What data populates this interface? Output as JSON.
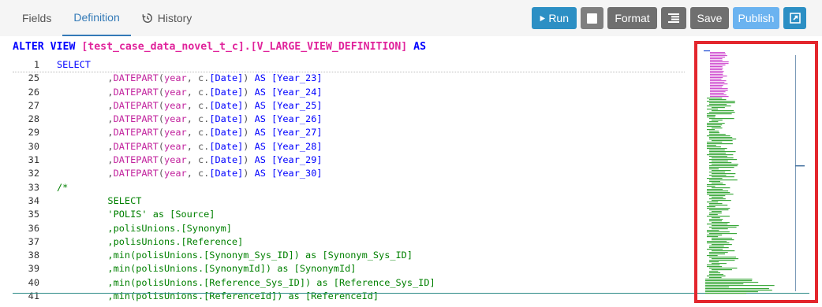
{
  "tabs": [
    {
      "label": "Fields",
      "active": false
    },
    {
      "label": "Definition",
      "active": true
    },
    {
      "label": "History",
      "active": false
    }
  ],
  "toolbar": {
    "run_label": "Run",
    "format_label": "Format",
    "save_label": "Save",
    "publish_label": "Publish"
  },
  "editor": {
    "header": {
      "keyword1": "ALTER VIEW ",
      "object_name": "[test_case_data_novel_t_c].[V_LARGE_VIEW_DEFINITION]",
      "keyword2": " AS"
    },
    "sticky_line": {
      "number": "1",
      "text": "SELECT"
    },
    "lines": [
      {
        "n": "25",
        "parts": [
          [
            "plain",
            "         ,"
          ],
          [
            "fn",
            "DATEPART"
          ],
          [
            "plain",
            "("
          ],
          [
            "fn",
            "year"
          ],
          [
            "plain",
            ", c."
          ],
          [
            "kw",
            "[Date]"
          ],
          [
            "plain",
            ") "
          ],
          [
            "kw",
            "AS [Year_23]"
          ]
        ]
      },
      {
        "n": "26",
        "parts": [
          [
            "plain",
            "         ,"
          ],
          [
            "fn",
            "DATEPART"
          ],
          [
            "plain",
            "("
          ],
          [
            "fn",
            "year"
          ],
          [
            "plain",
            ", c."
          ],
          [
            "kw",
            "[Date]"
          ],
          [
            "plain",
            ") "
          ],
          [
            "kw",
            "AS [Year_24]"
          ]
        ]
      },
      {
        "n": "27",
        "parts": [
          [
            "plain",
            "         ,"
          ],
          [
            "fn",
            "DATEPART"
          ],
          [
            "plain",
            "("
          ],
          [
            "fn",
            "year"
          ],
          [
            "plain",
            ", c."
          ],
          [
            "kw",
            "[Date]"
          ],
          [
            "plain",
            ") "
          ],
          [
            "kw",
            "AS [Year_25]"
          ]
        ]
      },
      {
        "n": "28",
        "parts": [
          [
            "plain",
            "         ,"
          ],
          [
            "fn",
            "DATEPART"
          ],
          [
            "plain",
            "("
          ],
          [
            "fn",
            "year"
          ],
          [
            "plain",
            ", c."
          ],
          [
            "kw",
            "[Date]"
          ],
          [
            "plain",
            ") "
          ],
          [
            "kw",
            "AS [Year_26]"
          ]
        ]
      },
      {
        "n": "29",
        "parts": [
          [
            "plain",
            "         ,"
          ],
          [
            "fn",
            "DATEPART"
          ],
          [
            "plain",
            "("
          ],
          [
            "fn",
            "year"
          ],
          [
            "plain",
            ", c."
          ],
          [
            "kw",
            "[Date]"
          ],
          [
            "plain",
            ") "
          ],
          [
            "kw",
            "AS [Year_27]"
          ]
        ]
      },
      {
        "n": "30",
        "parts": [
          [
            "plain",
            "         ,"
          ],
          [
            "fn",
            "DATEPART"
          ],
          [
            "plain",
            "("
          ],
          [
            "fn",
            "year"
          ],
          [
            "plain",
            ", c."
          ],
          [
            "kw",
            "[Date]"
          ],
          [
            "plain",
            ") "
          ],
          [
            "kw",
            "AS [Year_28]"
          ]
        ]
      },
      {
        "n": "31",
        "parts": [
          [
            "plain",
            "         ,"
          ],
          [
            "fn",
            "DATEPART"
          ],
          [
            "plain",
            "("
          ],
          [
            "fn",
            "year"
          ],
          [
            "plain",
            ", c."
          ],
          [
            "kw",
            "[Date]"
          ],
          [
            "plain",
            ") "
          ],
          [
            "kw",
            "AS [Year_29]"
          ]
        ]
      },
      {
        "n": "32",
        "parts": [
          [
            "plain",
            "         ,"
          ],
          [
            "fn",
            "DATEPART"
          ],
          [
            "plain",
            "("
          ],
          [
            "fn",
            "year"
          ],
          [
            "plain",
            ", c."
          ],
          [
            "kw",
            "[Date]"
          ],
          [
            "plain",
            ") "
          ],
          [
            "kw",
            "AS [Year_30]"
          ]
        ]
      },
      {
        "n": "33",
        "parts": [
          [
            "cm",
            "/*"
          ]
        ]
      },
      {
        "n": "34",
        "parts": [
          [
            "cm",
            "         SELECT"
          ]
        ]
      },
      {
        "n": "35",
        "parts": [
          [
            "cm",
            "         'POLIS' as [Source]"
          ]
        ]
      },
      {
        "n": "36",
        "parts": [
          [
            "cm",
            "         ,polisUnions.[Synonym]"
          ]
        ]
      },
      {
        "n": "37",
        "parts": [
          [
            "cm",
            "         ,polisUnions.[Reference]"
          ]
        ]
      },
      {
        "n": "38",
        "parts": [
          [
            "cm",
            "         ,min(polisUnions.[Synonym_Sys_ID]) as [Synonym_Sys_ID]"
          ]
        ]
      },
      {
        "n": "39",
        "parts": [
          [
            "cm",
            "         ,min(polisUnions.[SynonymId]) as [SynonymId]"
          ]
        ]
      },
      {
        "n": "40",
        "parts": [
          [
            "cm",
            "         ,min(polisUnions.[Reference_Sys_ID]) as [Reference_Sys_ID]"
          ]
        ]
      },
      {
        "n": "41",
        "parts": [
          [
            "cm",
            "         ,min(polisUnions.[ReferenceId]) as [ReferenceId]"
          ]
        ]
      }
    ]
  },
  "colors": {
    "accent": "#2c8fc4",
    "publish": "#6bb3f0",
    "highlight_frame": "#e3262d",
    "keyword": "#0000ff",
    "function": "#c2249e",
    "comment": "#008000"
  }
}
